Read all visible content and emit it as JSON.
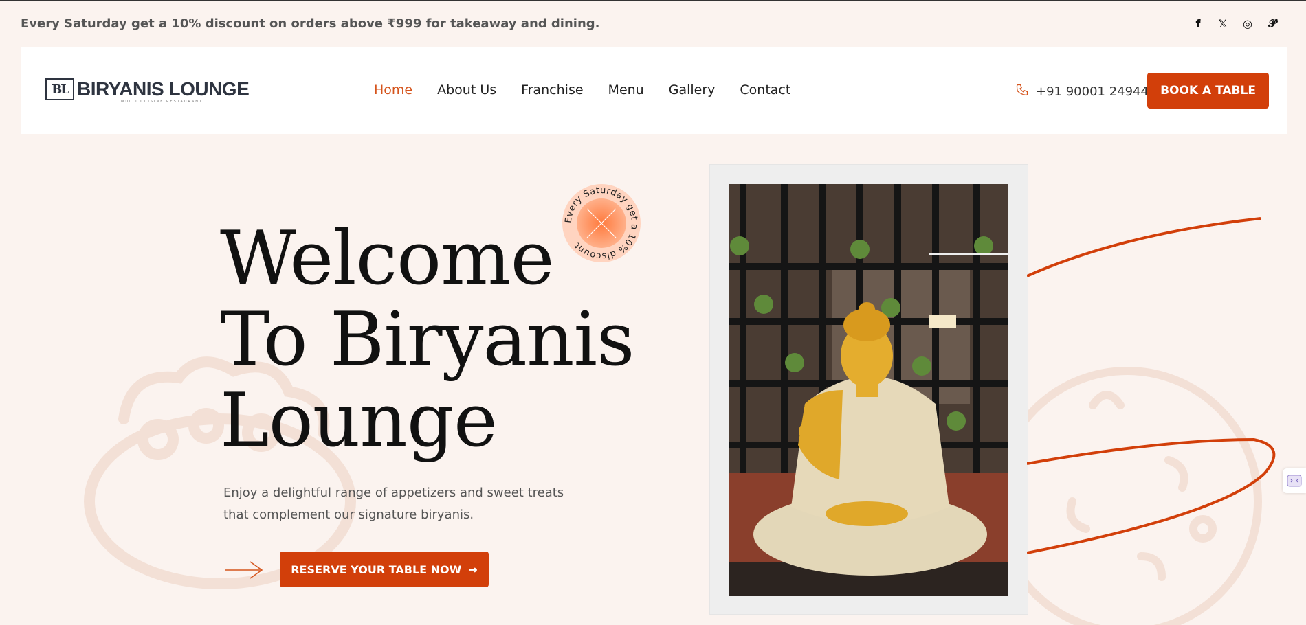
{
  "promo": {
    "text": "Every Saturday get a 10% discount on orders above ₹999 for takeaway and dining."
  },
  "social": [
    {
      "name": "facebook-icon",
      "glyph": "f"
    },
    {
      "name": "x-twitter-icon",
      "glyph": "𝕏"
    },
    {
      "name": "instagram-icon",
      "glyph": "◎"
    },
    {
      "name": "pinterest-icon",
      "glyph": "𝓟"
    }
  ],
  "header": {
    "logo_mark": "BL",
    "logo_text": "BIRYANIS LOUNGE",
    "logo_sub": "MULTI CUISINE RESTAURANT",
    "nav": [
      "Home",
      "About Us",
      "Franchise",
      "Menu",
      "Gallery",
      "Contact"
    ],
    "active_nav": "Home",
    "phone": "+91 90001 24944",
    "book_label": "BOOK A TABLE"
  },
  "hero": {
    "title_line1": "Welcome",
    "title_line2": "To Biryanis",
    "title_line3": "Lounge",
    "description": "Enjoy a delightful range of appetizers and sweet treats that complement our signature biryanis.",
    "reserve_label": "RESERVE YOUR TABLE NOW",
    "badge_text": "Every Saturday get a 10% discount"
  },
  "colors": {
    "accent": "#d23f0a",
    "background": "#fbf3ef",
    "nav_active": "#d5541c"
  }
}
